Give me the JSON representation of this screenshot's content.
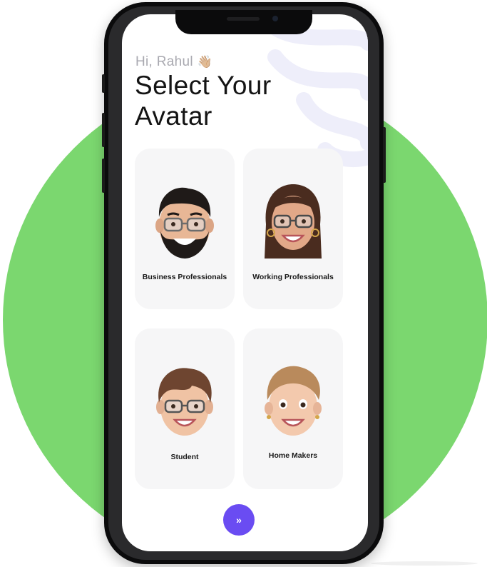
{
  "colors": {
    "background_circle": "#7bd76f",
    "accent": "#6a4cf2",
    "card_bg": "#f6f6f7",
    "title_text": "#141414",
    "greeting_text": "#a9a9b0"
  },
  "header": {
    "greeting": "Hi, Rahul",
    "greeting_emoji": "👋🏼",
    "title_line1": "Select Your",
    "title_line2": "Avatar"
  },
  "avatars": [
    {
      "label": "Business Professionals",
      "icon": "bearded-man-glasses-icon"
    },
    {
      "label": "Working Professionals",
      "icon": "woman-glasses-icon"
    },
    {
      "label": "Student",
      "icon": "boy-glasses-icon"
    },
    {
      "label": "Home Makers",
      "icon": "woman-bun-icon"
    }
  ],
  "next_button": {
    "icon": "double-chevron-right-icon",
    "symbol": "»"
  }
}
